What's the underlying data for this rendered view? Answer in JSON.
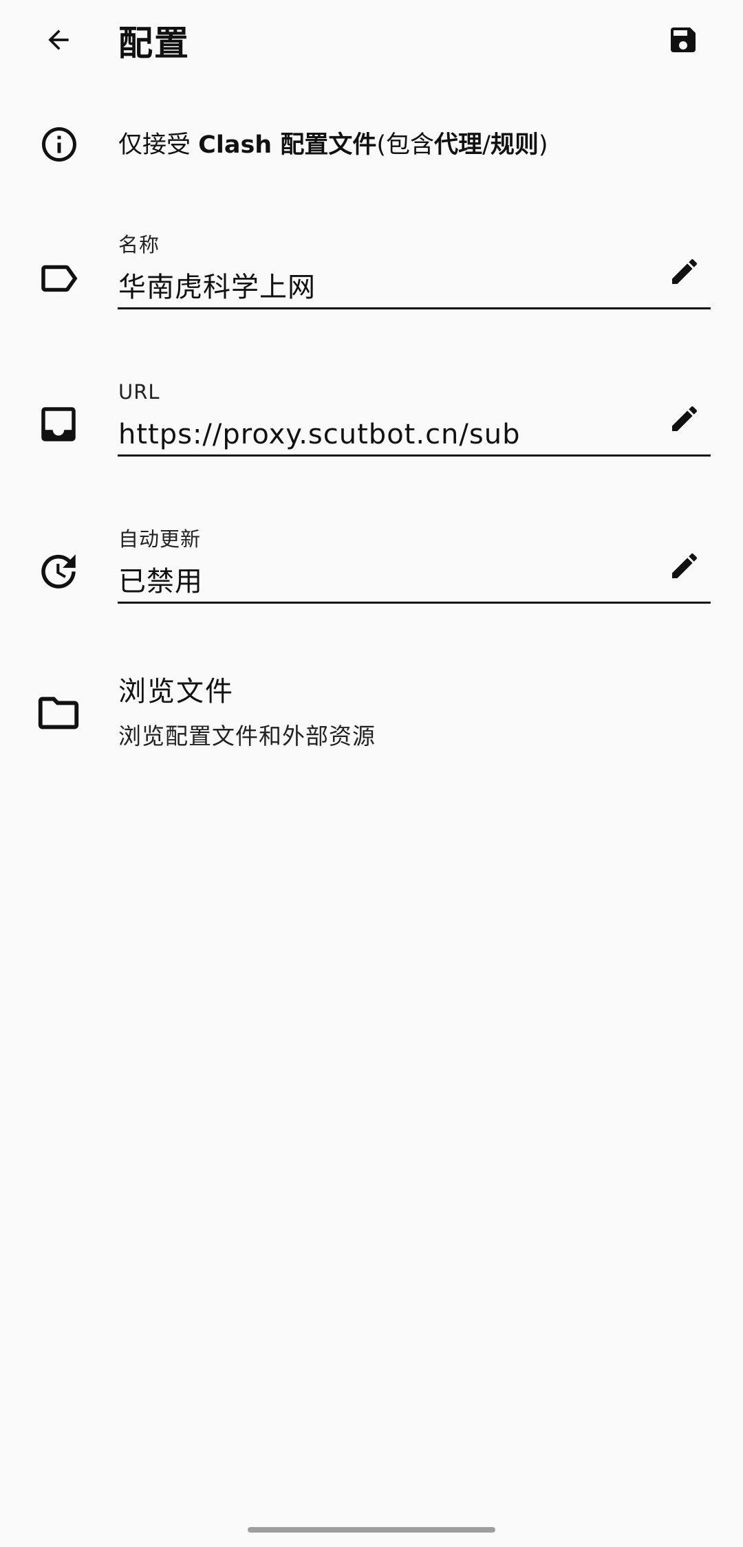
{
  "appbar": {
    "title": "配置",
    "back_icon": "arrow-back-icon",
    "save_icon": "save-icon"
  },
  "info": {
    "icon": "info-icon",
    "prefix": "仅接受 ",
    "strong1": "Clash 配置文件",
    "paren_open": "(包含",
    "strong2": "代理",
    "slash": "/",
    "strong3": "规则",
    "paren_close": ")"
  },
  "fields": {
    "name": {
      "label": "名称",
      "value": "华南虎科学上网",
      "icon": "label-icon"
    },
    "url": {
      "label": "URL",
      "value": "https://proxy.scutbot.cn/sub",
      "icon": "inbox-icon"
    },
    "auto_update": {
      "label": "自动更新",
      "value": "已禁用",
      "icon": "update-icon"
    }
  },
  "browse": {
    "title": "浏览文件",
    "subtitle": "浏览配置文件和外部资源",
    "icon": "folder-icon"
  },
  "colors": {
    "background": "#fafafa",
    "foreground": "#111111",
    "home_indicator": "#9e9e9e"
  }
}
